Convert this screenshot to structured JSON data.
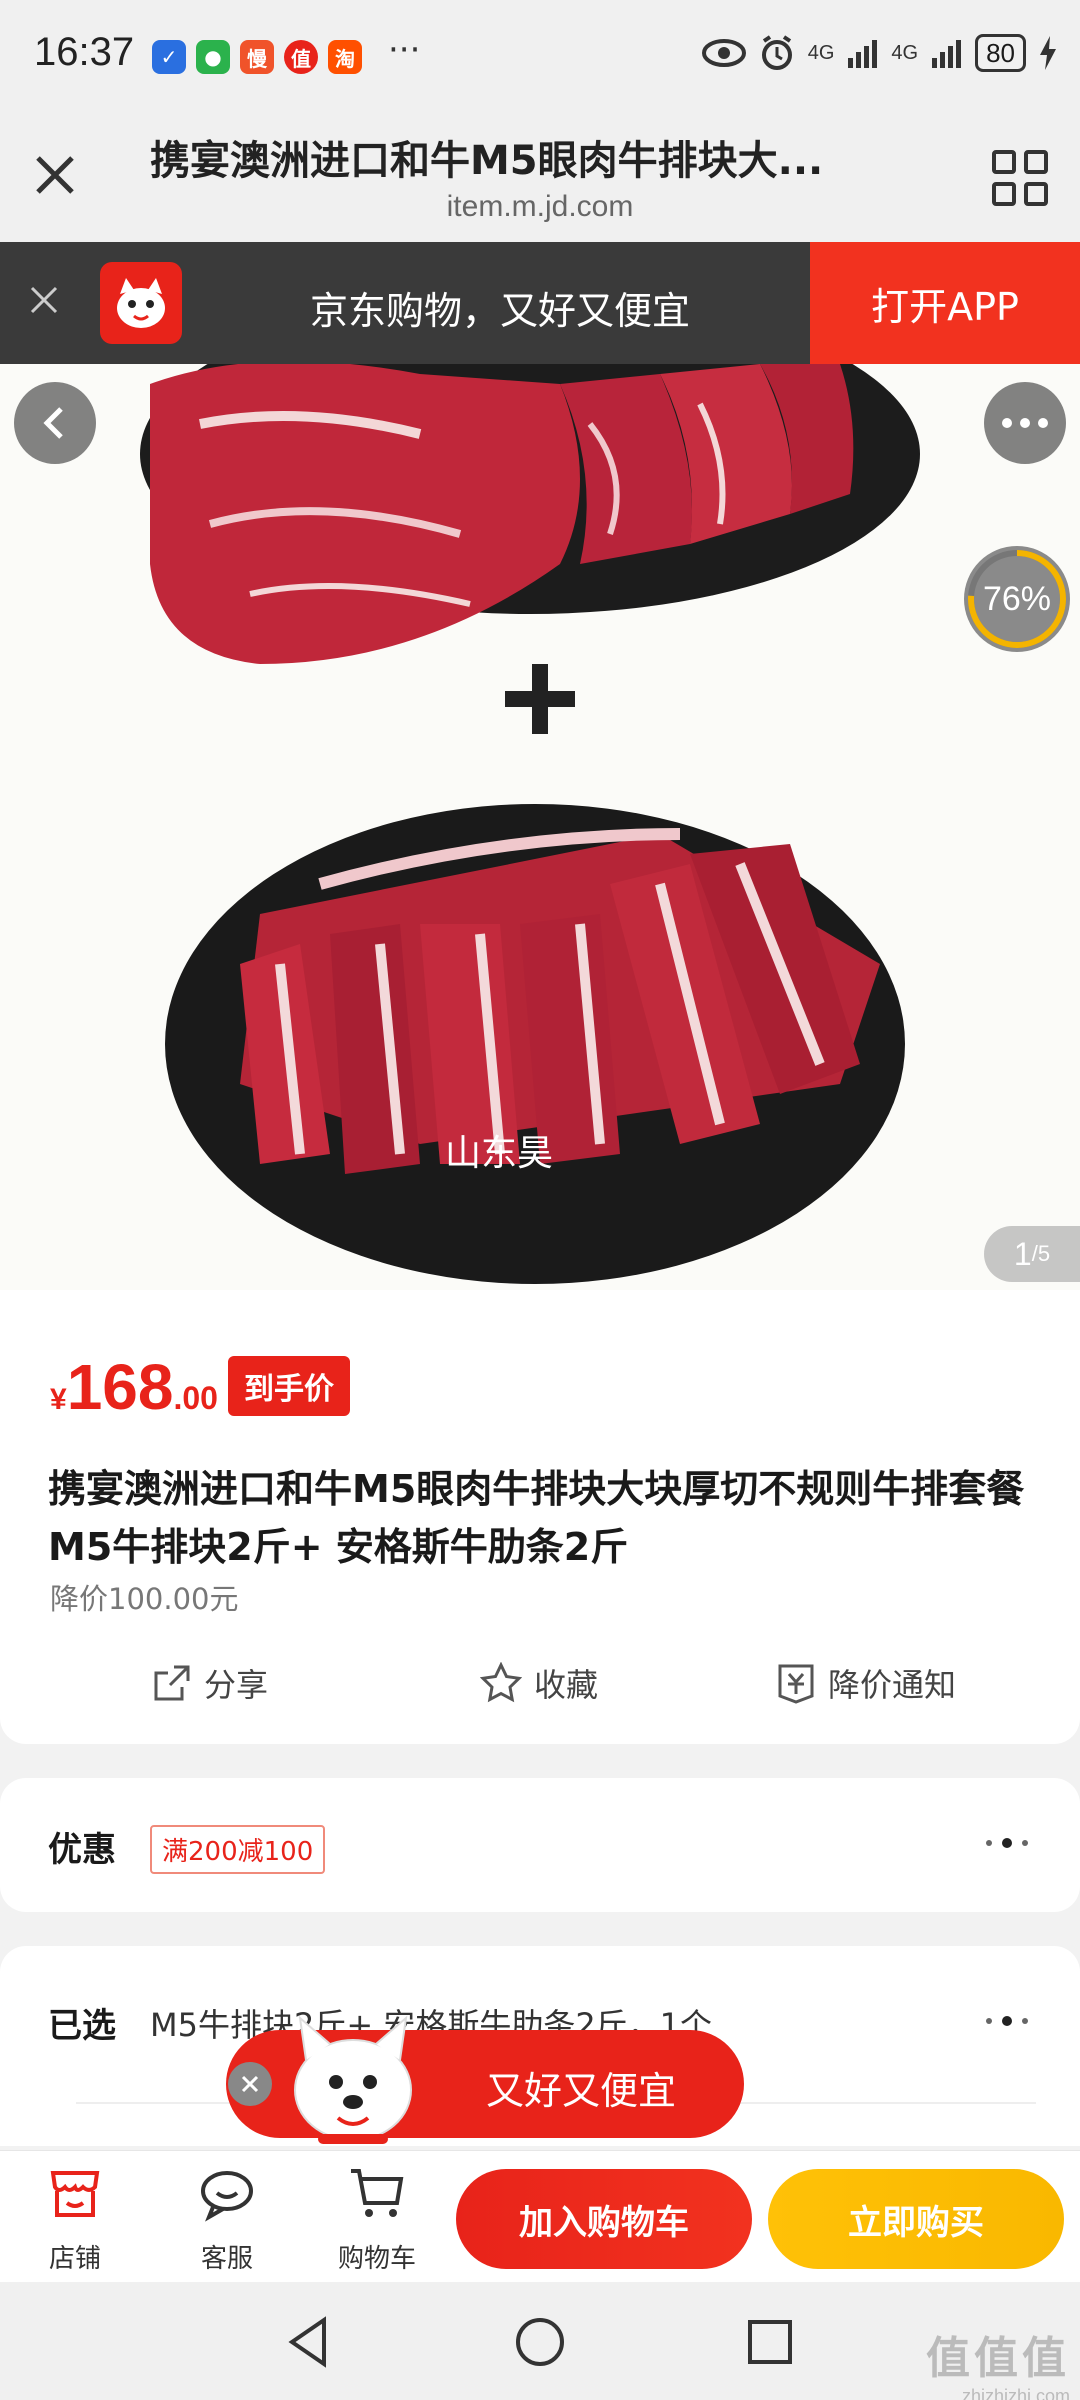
{
  "status_bar": {
    "time": "16:37",
    "app_icons": [
      "shield-app-icon",
      "wechat-icon",
      "man-app-icon",
      "zhi-app-icon",
      "taobao-icon"
    ],
    "app_labels": [
      "",
      "",
      "慢",
      "值",
      "淘"
    ],
    "more": "···",
    "signal1": "4G",
    "signal2": "4G",
    "battery": "80"
  },
  "title_bar": {
    "title": "携宴澳洲进口和牛M5眼肉牛排块大...",
    "url": "item.m.jd.com"
  },
  "banner": {
    "text": "京东购物，又好又便宜",
    "open_button": "打开APP"
  },
  "gallery": {
    "watermark": "山东昊",
    "progress": "76%",
    "progress_value": 0.76,
    "current": "1",
    "total": "/5"
  },
  "product": {
    "currency": "¥",
    "price_int": "168",
    "price_dec": ".00",
    "price_tag": "到手价",
    "title": "携宴澳洲进口和牛M5眼肉牛排块大块厚切不规则牛排套餐 M5牛排块2斤+ 安格斯牛肋条2斤",
    "price_drop": "降价100.00元",
    "actions": {
      "share": "分享",
      "favorite": "收藏",
      "notify": "降价通知"
    }
  },
  "promo": {
    "label": "优惠",
    "tag": "满200减100"
  },
  "selected": {
    "label": "已选",
    "value": "M5牛排块2斤+ 安格斯牛肋条2斤，1个"
  },
  "floating_promo": {
    "text": "又好又便宜"
  },
  "bottom_bar": {
    "store": "店铺",
    "service": "客服",
    "cart": "购物车",
    "add_to_cart": "加入购物车",
    "buy_now": "立即购买"
  },
  "watermark": {
    "main": "值值值",
    "sub": "zhizhizhi.com"
  },
  "colors": {
    "accent": "#e8231a",
    "buy": "#f9b800",
    "banner_bg": "#3a3a3a"
  }
}
